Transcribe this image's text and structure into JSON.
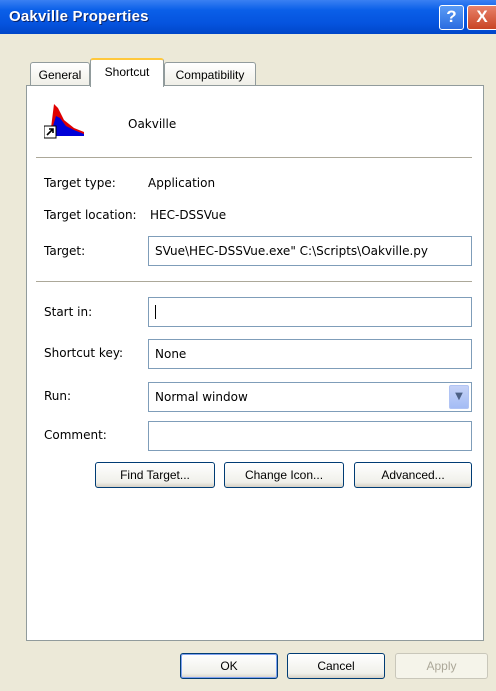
{
  "window": {
    "title": "Oakville Properties",
    "help_label": "?",
    "close_label": "X"
  },
  "tabs": [
    {
      "label": "General"
    },
    {
      "label": "Shortcut"
    },
    {
      "label": "Compatibility"
    }
  ],
  "app": {
    "name": "Oakville",
    "icon": "chart-shortcut-icon"
  },
  "fields": {
    "target_type_label": "Target type:",
    "target_type_value": "Application",
    "target_location_label": "Target location:",
    "target_location_value": "HEC-DSSVue",
    "target_label": "Target:",
    "target_value": "SVue\\HEC-DSSVue.exe\" C:\\Scripts\\Oakville.py",
    "start_in_label": "Start in:",
    "start_in_value": "",
    "shortcut_key_label": "Shortcut key:",
    "shortcut_key_value": "None",
    "run_label": "Run:",
    "run_value": "Normal window",
    "comment_label": "Comment:",
    "comment_value": ""
  },
  "buttons": {
    "find_target": "Find Target...",
    "change_icon": "Change Icon...",
    "advanced": "Advanced...",
    "ok": "OK",
    "cancel": "Cancel",
    "apply": "Apply"
  }
}
